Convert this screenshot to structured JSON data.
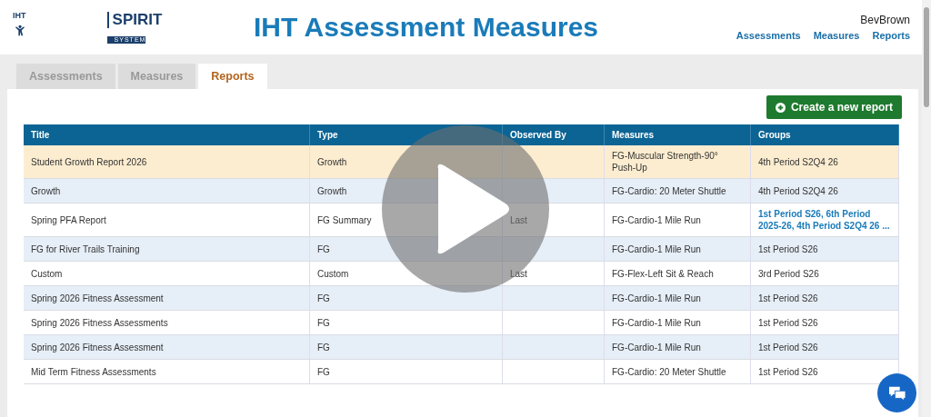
{
  "header": {
    "logo_top": "IHT",
    "logo_main": "SPIRIT",
    "logo_sub": "SYSTEM",
    "title": "IHT Assessment Measures",
    "user": "BevBrown",
    "nav": [
      "Assessments",
      "Measures",
      "Reports"
    ]
  },
  "tabs": [
    {
      "label": "Assessments",
      "selected": false
    },
    {
      "label": "Measures",
      "selected": false
    },
    {
      "label": "Reports",
      "selected": true
    }
  ],
  "create_button": "Create a new report",
  "table": {
    "columns": [
      "Title",
      "Type",
      "Observed By",
      "Measures",
      "Groups"
    ],
    "rows": [
      {
        "selected": true,
        "title": "Student Growth Report 2026",
        "type": "Growth",
        "observed_by": "",
        "measures": "FG-Muscular Strength-90° Push-Up",
        "groups": "4th Period S2Q4 26",
        "groups_link": false
      },
      {
        "selected": false,
        "title": "Growth",
        "type": "Growth",
        "observed_by": "",
        "measures": "FG-Cardio: 20 Meter Shuttle",
        "groups": "4th Period S2Q4 26",
        "groups_link": false
      },
      {
        "selected": false,
        "title": "Spring PFA Report",
        "type": "FG Summary",
        "observed_by": "Last",
        "measures": "FG-Cardio-1 Mile Run",
        "groups": "1st Period S26, 6th Period 2025-26, 4th Period S2Q4 26 ...",
        "groups_link": true
      },
      {
        "selected": false,
        "title": "FG for River Trails Training",
        "type": "FG",
        "observed_by": "",
        "measures": "FG-Cardio-1 Mile Run",
        "groups": "1st Period S26",
        "groups_link": false
      },
      {
        "selected": false,
        "title": "Custom",
        "type": "Custom",
        "observed_by": "Last",
        "measures": "FG-Flex-Left Sit & Reach",
        "groups": "3rd Period S26",
        "groups_link": false
      },
      {
        "selected": false,
        "title": "Spring 2026 Fitness Assessment",
        "type": "FG",
        "observed_by": "",
        "measures": "FG-Cardio-1 Mile Run",
        "groups": "1st Period S26",
        "groups_link": false
      },
      {
        "selected": false,
        "title": "Spring 2026 Fitness Assessments",
        "type": "FG",
        "observed_by": "",
        "measures": "FG-Cardio-1 Mile Run",
        "groups": "1st Period S26",
        "groups_link": false
      },
      {
        "selected": false,
        "title": "Spring 2026 Fitness Assessment",
        "type": "FG",
        "observed_by": "",
        "measures": "FG-Cardio-1 Mile Run",
        "groups": "1st Period S26",
        "groups_link": false
      },
      {
        "selected": false,
        "title": "Mid Term Fitness Assessments",
        "type": "FG",
        "observed_by": "",
        "measures": "FG-Cardio: 20 Meter Shuttle",
        "groups": "1st Period S26",
        "groups_link": false
      }
    ]
  }
}
